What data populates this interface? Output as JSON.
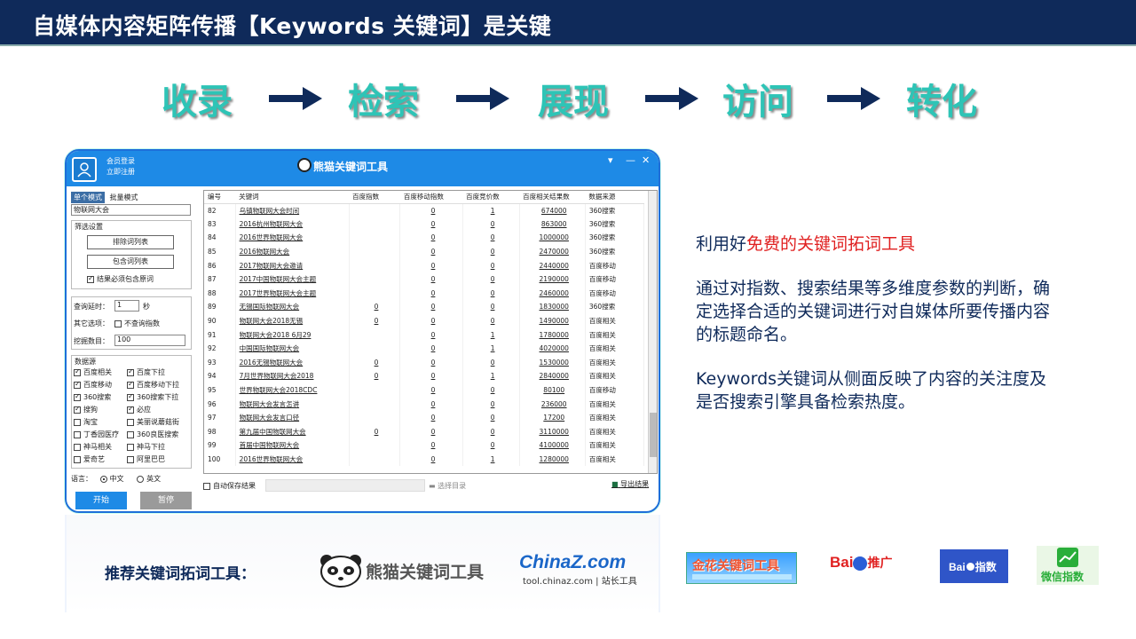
{
  "header": {
    "title": "自媒体内容矩阵传播【Keywords 关键词】是关键"
  },
  "flow": {
    "steps": [
      "收录",
      "检索",
      "展现",
      "访问",
      "转化"
    ]
  },
  "app": {
    "login": "会员登录",
    "register": "立即注册",
    "title": "熊猫关键词工具",
    "mode_single": "单个模式",
    "mode_batch": "批量模式",
    "keyword_value": "物联网大会",
    "filter_title": "筛选设置",
    "btn_exclude": "排除词列表",
    "btn_include": "包含词列表",
    "must_include": "结果必须包含原词",
    "query_delay_label": "查询延时：",
    "query_delay_value": "1",
    "query_delay_unit": "秒",
    "other_label": "其它选项：",
    "no_index": "不查询指数",
    "dig_label": "挖掘数目：",
    "dig_value": "100",
    "source_title": "数据源",
    "sources": [
      {
        "label": "百度相关",
        "on": true
      },
      {
        "label": "百度下拉",
        "on": true
      },
      {
        "label": "百度移动",
        "on": true
      },
      {
        "label": "百度移动下拉",
        "on": true
      },
      {
        "label": "360搜索",
        "on": true
      },
      {
        "label": "360搜索下拉",
        "on": true
      },
      {
        "label": "搜狗",
        "on": true
      },
      {
        "label": "必应",
        "on": true
      },
      {
        "label": "淘宝",
        "on": false
      },
      {
        "label": "美丽说蘑菇街",
        "on": false
      },
      {
        "label": "丁香园医疗",
        "on": false
      },
      {
        "label": "360良医搜索",
        "on": false
      },
      {
        "label": "神马相关",
        "on": false
      },
      {
        "label": "神马下拉",
        "on": false
      },
      {
        "label": "爱奇艺",
        "on": false
      },
      {
        "label": "阿里巴巴",
        "on": false
      }
    ],
    "lang_label": "语言：",
    "lang_cn": "中文",
    "lang_en": "英文",
    "start": "开始",
    "stop": "暂停",
    "columns": [
      "编号",
      "关键词",
      "百度指数",
      "百度移动指数",
      "百度竞价数",
      "百度相关结果数",
      "数据来源"
    ],
    "rows": [
      [
        "82",
        "乌镇物联网大会时间",
        "",
        "0",
        "1",
        "674000",
        "360搜索"
      ],
      [
        "83",
        "2016杭州物联网大会",
        "",
        "0",
        "0",
        "863000",
        "360搜索"
      ],
      [
        "84",
        "2016世界物联网大会",
        "",
        "0",
        "0",
        "1000000",
        "360搜索"
      ],
      [
        "85",
        "2016物联网大会",
        "",
        "0",
        "0",
        "2470000",
        "360搜索"
      ],
      [
        "86",
        "2017物联网大会邀请",
        "",
        "0",
        "0",
        "2440000",
        "百度移动"
      ],
      [
        "87",
        "2017中国物联网大会主题",
        "",
        "0",
        "0",
        "2190000",
        "百度移动"
      ],
      [
        "88",
        "2017世界物联网大会主题",
        "",
        "0",
        "0",
        "2460000",
        "百度移动"
      ],
      [
        "89",
        "无锡国际物联网大会",
        "0",
        "0",
        "0",
        "1830000",
        "360搜索"
      ],
      [
        "90",
        "物联网大会2018无锡",
        "0",
        "0",
        "0",
        "1490000",
        "百度相关"
      ],
      [
        "91",
        "物联网大会2018 6月29",
        "",
        "0",
        "1",
        "1780000",
        "百度相关"
      ],
      [
        "92",
        "中国国际物联网大会",
        "",
        "0",
        "1",
        "4020000",
        "百度相关"
      ],
      [
        "93",
        "2016无锡物联网大会",
        "0",
        "0",
        "0",
        "1530000",
        "百度相关"
      ],
      [
        "94",
        "7月世界物联网大会2018",
        "0",
        "0",
        "1",
        "2840000",
        "百度相关"
      ],
      [
        "95",
        "世界物联网大会2018CDC",
        "",
        "0",
        "0",
        "80100",
        "百度移动"
      ],
      [
        "96",
        "物联网大会发言怎讲",
        "",
        "0",
        "0",
        "236000",
        "百度相关"
      ],
      [
        "97",
        "物联网大会发言口径",
        "",
        "0",
        "0",
        "17200",
        "百度相关"
      ],
      [
        "98",
        "第九届中国物联网大会",
        "0",
        "0",
        "0",
        "3110000",
        "百度相关"
      ],
      [
        "99",
        "首届中国物联网大会",
        "",
        "0",
        "0",
        "4100000",
        "百度相关"
      ],
      [
        "100",
        "2016世界物联网大会",
        "",
        "0",
        "1",
        "1280000",
        "百度相关"
      ]
    ],
    "auto_save": "自动保存结果",
    "choose_dir": "选择目录",
    "export": "导出结果"
  },
  "right": {
    "line1_prefix": "利用好",
    "line1_highlight": "免费的关键词拓词工具",
    "para2": [
      "通过对指数、搜索结果等多维度参数的判断，确",
      "定选择合适的关键词进行对自媒体所要传播内容",
      "的标题命名。"
    ],
    "para3": [
      "Keywords关键词从侧面反映了内容的关注度及",
      "是否搜索引擎具备检索热度。"
    ]
  },
  "recommend": {
    "label": "推荐关键词拓词工具：",
    "panda": "熊猫关键词工具",
    "chinaz_main": "ChinaZ.com",
    "chinaz_sub": "tool.chinaz.com | 站长工具",
    "jinhua": "金花关键词工具",
    "baidu_tg": "推广",
    "baidu_index": "指数",
    "wechat": "微信指数"
  },
  "colors": {
    "navy": "#0f2a5a",
    "teal": "#2ec4b6",
    "blue": "#1e8ae6",
    "red": "#e02020"
  }
}
